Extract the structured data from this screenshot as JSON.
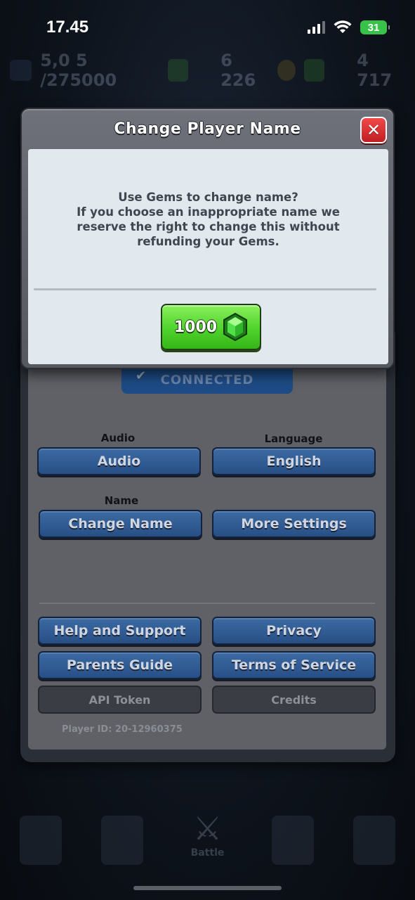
{
  "status_bar": {
    "time": "17.45",
    "battery": "31"
  },
  "background": {
    "resource_1": "5,0 5 /275000",
    "resource_2": "6 226",
    "resource_3": "4 717"
  },
  "modal": {
    "title": "Change Player Name",
    "message_lines": [
      "Use Gems to change name?",
      "If you choose an inappropriate name we",
      "reserve the right to change this without",
      "refunding your Gems."
    ],
    "gem_button_cost": "1000"
  },
  "settings": {
    "connected_label": "CONNECTED",
    "audio_label": "Audio",
    "audio_button": "Audio",
    "language_label": "Language",
    "language_button": "English",
    "name_label": "Name",
    "change_name_button": "Change Name",
    "more_settings_button": "More Settings",
    "help_button": "Help and Support",
    "privacy_button": "Privacy",
    "parents_guide_button": "Parents Guide",
    "terms_button": "Terms of Service",
    "api_token_button": "API Token",
    "credits_button": "Credits",
    "player_id": "Player ID: 20-12960375"
  },
  "bottom_nav": {
    "battle_label": "Battle"
  },
  "colors": {
    "accent_green": "#4fd32c",
    "close_red": "#c21d22",
    "button_blue": "#274f86"
  },
  "icons": [
    "signal-icon",
    "wifi-icon",
    "battery-icon",
    "close-icon",
    "gem-icon",
    "check-icon",
    "swords-icon"
  ]
}
